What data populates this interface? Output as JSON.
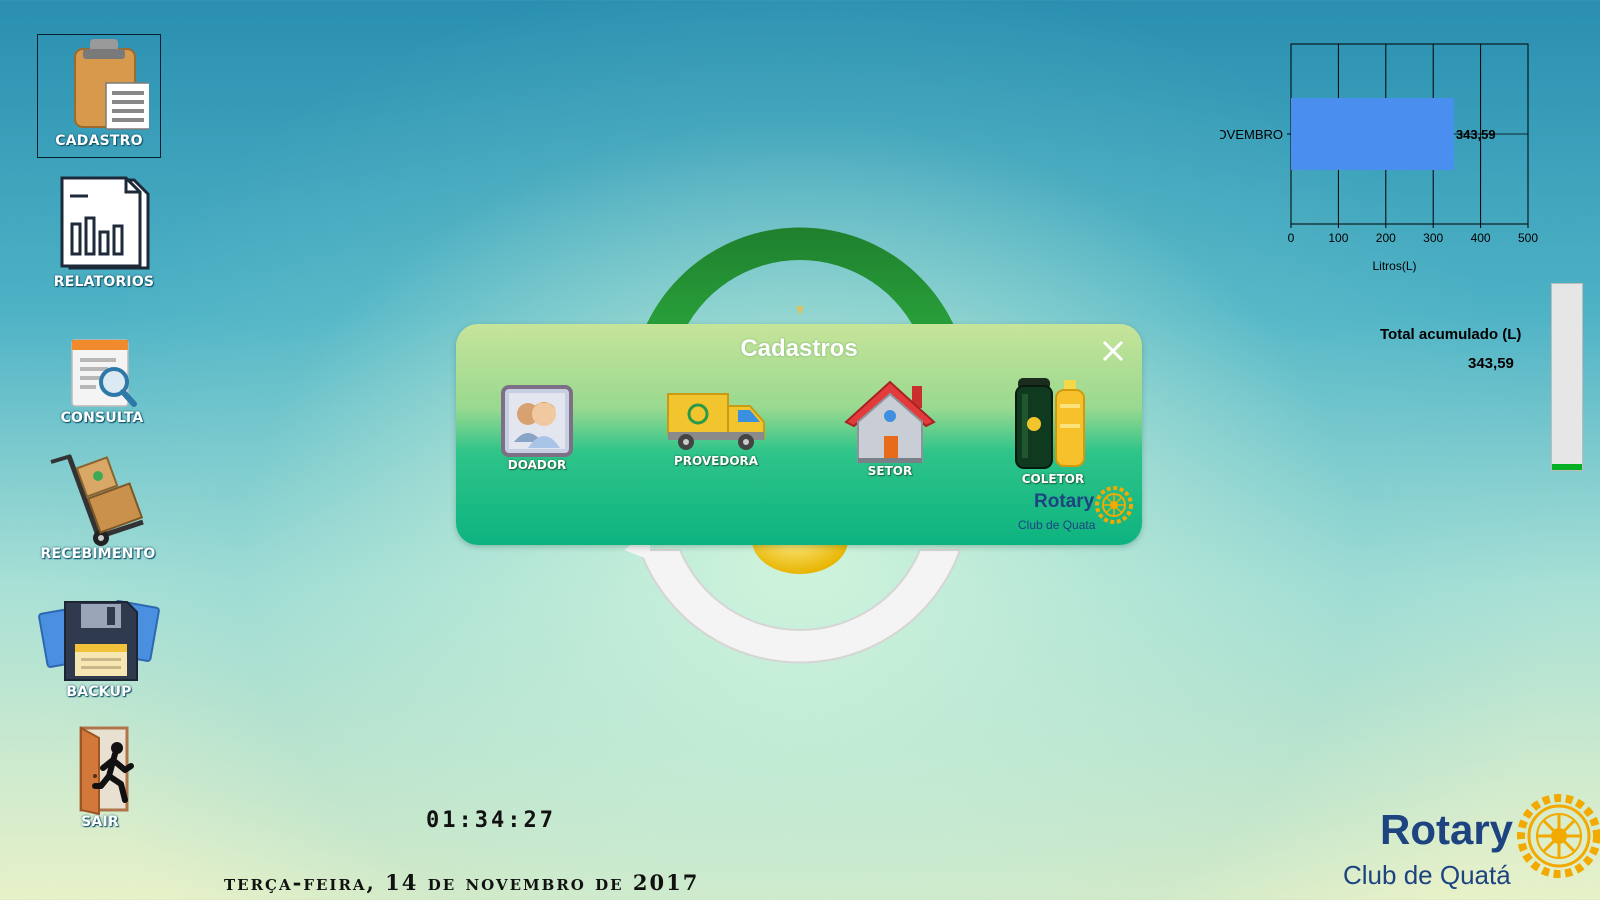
{
  "desktop": {
    "icons": [
      {
        "label": "CADASTRO"
      },
      {
        "label": "RELATORIOS"
      },
      {
        "label": "CONSULTA"
      },
      {
        "label": "RECEBIMENTO"
      },
      {
        "label": "BACKUP"
      },
      {
        "label": "SAIR"
      }
    ]
  },
  "dialog": {
    "title": "Cadastros",
    "items": [
      {
        "label": "DOADOR"
      },
      {
        "label": "PROVEDORA"
      },
      {
        "label": "SETOR"
      },
      {
        "label": "COLETOR"
      }
    ],
    "logo": {
      "word": "Rotary",
      "sub": "Club de Quata"
    }
  },
  "chart_data": {
    "type": "bar",
    "orientation": "horizontal",
    "categories": [
      "NOVEMBRO"
    ],
    "values": [
      343.59
    ],
    "data_labels": [
      "343,59"
    ],
    "xlabel": "Litros(L)",
    "xlim": [
      0,
      500
    ],
    "xticks": [
      "0",
      "100",
      "200",
      "300",
      "400",
      "500"
    ],
    "grid": true,
    "bar_color": "#4a8ef0"
  },
  "totals": {
    "label": "Total acumulado (L)",
    "value": "343,59",
    "progress_fraction": 0.035
  },
  "clock": {
    "time": "01:34:27"
  },
  "date": {
    "text": "terça-feira, 14 de novembro de 2017"
  },
  "branding": {
    "word": "Rotary",
    "sub": "Club de Quatá"
  },
  "colors": {
    "rotary_blue": "#1d4380",
    "rotary_gold": "#f2a900",
    "progress_green": "#06b025"
  }
}
